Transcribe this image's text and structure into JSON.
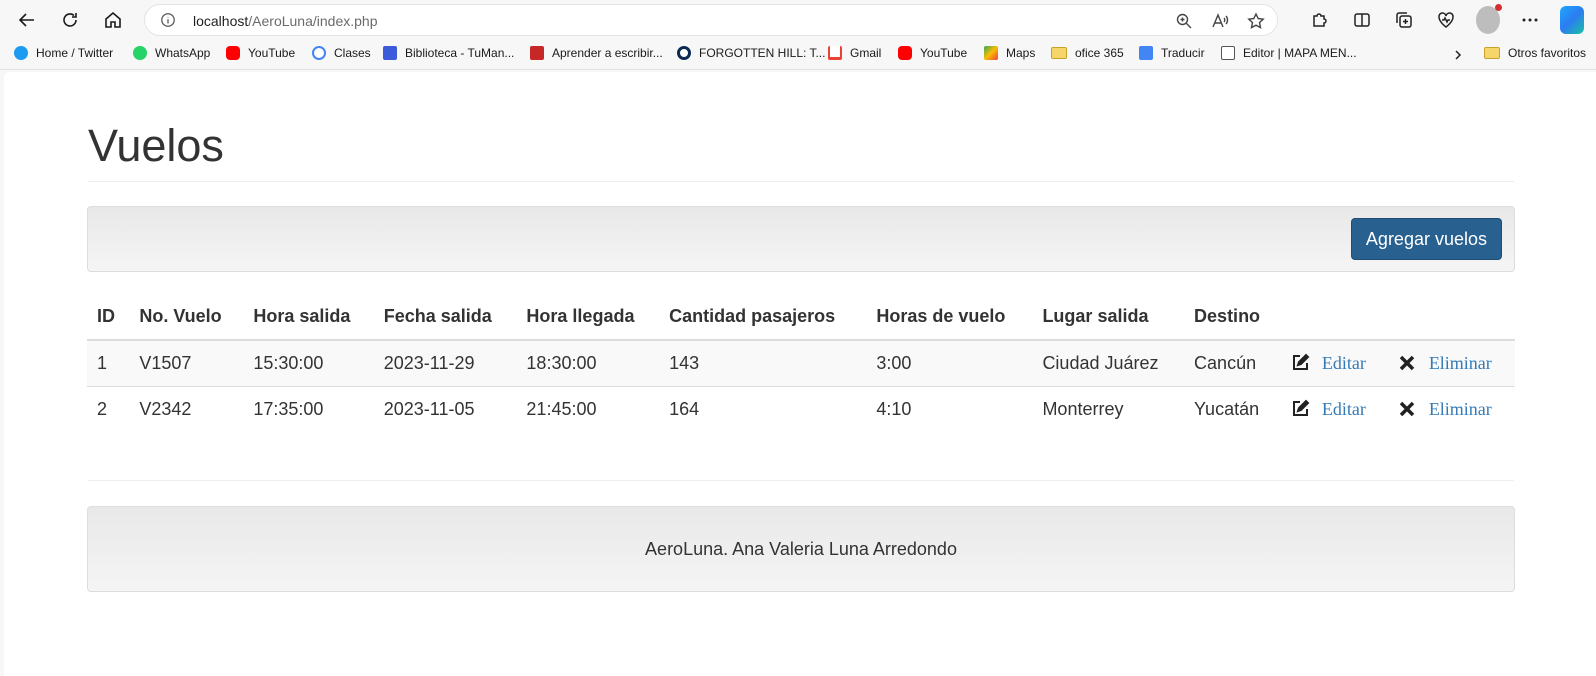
{
  "browser": {
    "url_host": "localhost",
    "url_path": "/AeroLuna/index.php",
    "bookmarks": [
      {
        "label": "Home / Twitter",
        "icon": "twitter-icon",
        "color": "#1d9bf0"
      },
      {
        "label": "WhatsApp",
        "icon": "whatsapp-icon",
        "color": "#25d366"
      },
      {
        "label": "YouTube",
        "icon": "youtube-icon",
        "color": "#ff0000"
      },
      {
        "label": "Clases",
        "icon": "google-icon",
        "color": "#4285f4"
      },
      {
        "label": "Biblioteca - TuMan...",
        "icon": "library-icon",
        "color": "#3b5bdb"
      },
      {
        "label": "Aprender a escribir...",
        "icon": "book-icon",
        "color": "#c62828"
      },
      {
        "label": "FORGOTTEN HILL: T...",
        "icon": "circle-logo-icon",
        "color": "#0d2a52"
      },
      {
        "label": "Gmail",
        "icon": "gmail-icon",
        "color": "#ea4335"
      },
      {
        "label": "YouTube",
        "icon": "youtube-icon",
        "color": "#ff0000"
      },
      {
        "label": "Maps",
        "icon": "maps-icon",
        "color": "#34a853"
      },
      {
        "label": "ofice 365",
        "icon": "folder-icon",
        "color": "#f6d66b"
      },
      {
        "label": "Traducir",
        "icon": "translate-icon",
        "color": "#4285f4"
      },
      {
        "label": "Editor | MAPA MEN...",
        "icon": "page-icon",
        "color": "#555555"
      }
    ],
    "other_favorites": "Otros favoritos"
  },
  "page": {
    "title": "Vuelos",
    "add_button": "Agregar vuelos",
    "columns": [
      "ID",
      "No. Vuelo",
      "Hora salida",
      "Fecha salida",
      "Hora llegada",
      "Cantidad pasajeros",
      "Horas de vuelo",
      "Lugar salida",
      "Destino"
    ],
    "rows": [
      {
        "id": "1",
        "vuelo": "V1507",
        "hora_salida": "15:30:00",
        "fecha_salida": "2023-11-29",
        "hora_llegada": "18:30:00",
        "pasajeros": "143",
        "horas_vuelo": "3:00",
        "lugar_salida": "Ciudad Juárez",
        "destino": "Cancún",
        "edit": "Editar",
        "delete": "Eliminar"
      },
      {
        "id": "2",
        "vuelo": "V2342",
        "hora_salida": "17:35:00",
        "fecha_salida": "2023-11-05",
        "hora_llegada": "21:45:00",
        "pasajeros": "164",
        "horas_vuelo": "4:10",
        "lugar_salida": "Monterrey",
        "destino": "Yucatán",
        "edit": "Editar",
        "delete": "Eliminar"
      }
    ],
    "footer": "AeroLuna. Ana Valeria Luna Arredondo",
    "accent": "#286090",
    "link_color": "#337ab7"
  }
}
